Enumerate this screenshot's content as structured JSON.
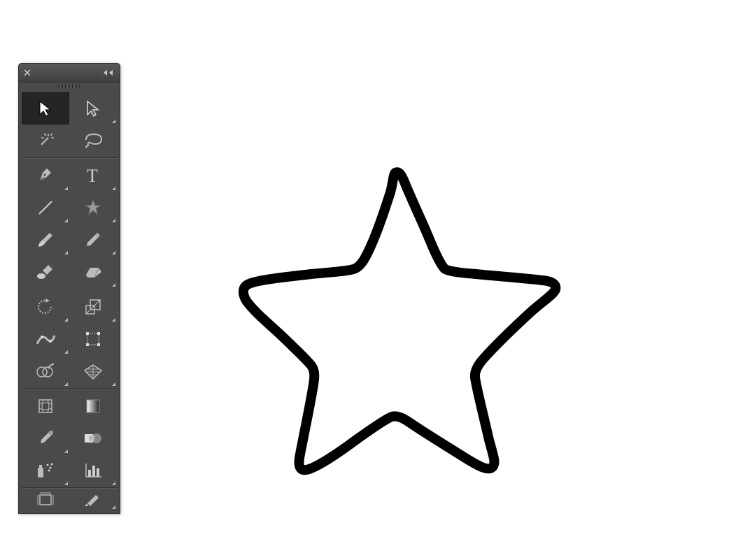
{
  "palette": {
    "panel_bg": "#4a4a4a",
    "panel_dark": "#3a3a3a",
    "selected_bg": "#252525",
    "icon_grey": "#b8b8b8"
  },
  "tools": [
    {
      "name": "selection-tool",
      "selected": true,
      "flyout": false
    },
    {
      "name": "direct-selection-tool",
      "selected": false,
      "flyout": true
    },
    {
      "name": "magic-wand-tool",
      "selected": false,
      "flyout": false
    },
    {
      "name": "lasso-tool",
      "selected": false,
      "flyout": false
    },
    {
      "name": "pen-tool",
      "selected": false,
      "flyout": true
    },
    {
      "name": "type-tool",
      "selected": false,
      "flyout": true
    },
    {
      "name": "line-segment-tool",
      "selected": false,
      "flyout": true
    },
    {
      "name": "shape-star-tool",
      "selected": false,
      "flyout": true
    },
    {
      "name": "paintbrush-tool",
      "selected": false,
      "flyout": true
    },
    {
      "name": "pencil-tool",
      "selected": false,
      "flyout": true
    },
    {
      "name": "blob-brush-tool",
      "selected": false,
      "flyout": false
    },
    {
      "name": "eraser-tool",
      "selected": false,
      "flyout": true
    },
    {
      "name": "rotate-tool",
      "selected": false,
      "flyout": true
    },
    {
      "name": "scale-tool",
      "selected": false,
      "flyout": true
    },
    {
      "name": "width-tool",
      "selected": false,
      "flyout": true
    },
    {
      "name": "free-transform-tool",
      "selected": false,
      "flyout": false
    },
    {
      "name": "shape-builder-tool",
      "selected": false,
      "flyout": true
    },
    {
      "name": "perspective-grid-tool",
      "selected": false,
      "flyout": true
    },
    {
      "name": "mesh-tool",
      "selected": false,
      "flyout": false
    },
    {
      "name": "gradient-tool",
      "selected": false,
      "flyout": false
    },
    {
      "name": "eyedropper-tool",
      "selected": false,
      "flyout": true
    },
    {
      "name": "blend-tool",
      "selected": false,
      "flyout": false
    },
    {
      "name": "symbol-sprayer-tool",
      "selected": false,
      "flyout": true
    },
    {
      "name": "column-graph-tool",
      "selected": false,
      "flyout": true
    },
    {
      "name": "artboard-tool",
      "selected": false,
      "flyout": false
    },
    {
      "name": "slice-tool",
      "selected": false,
      "flyout": true
    }
  ],
  "canvas_shape": {
    "type": "hand-drawn-star",
    "stroke": "#000000",
    "fill": "none",
    "stroke_width": 14
  }
}
